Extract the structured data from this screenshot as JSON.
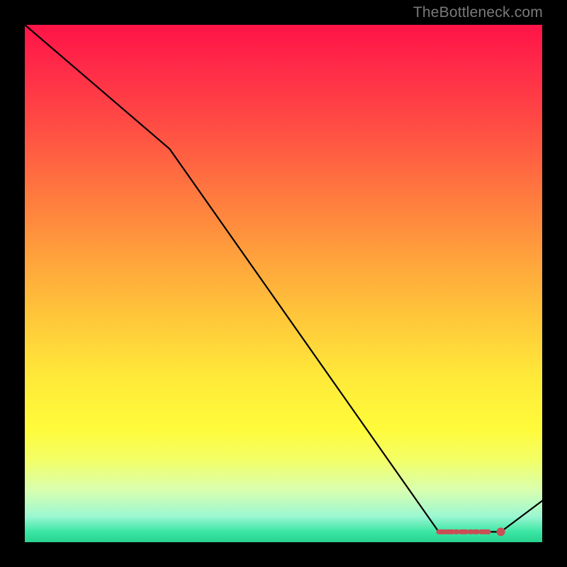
{
  "watermark": "TheBottleneck.com",
  "colors": {
    "curve": "#000000",
    "marker": "#c94f55",
    "gradient_top": "#ff1447",
    "gradient_bottom": "#27d38f"
  },
  "chart_data": {
    "type": "line",
    "title": "",
    "xlabel": "",
    "ylabel": "",
    "xlim": [
      0,
      100
    ],
    "ylim": [
      0,
      100
    ],
    "series": [
      {
        "name": "bottleneck-curve",
        "x": [
          0,
          28,
          80,
          92,
          100
        ],
        "y": [
          100,
          76,
          2,
          2,
          8
        ]
      }
    ],
    "markers": {
      "name": "highlight-segment",
      "x_range": [
        80,
        92
      ],
      "y": 2,
      "endpoint": {
        "x": 92,
        "y": 2
      }
    }
  }
}
